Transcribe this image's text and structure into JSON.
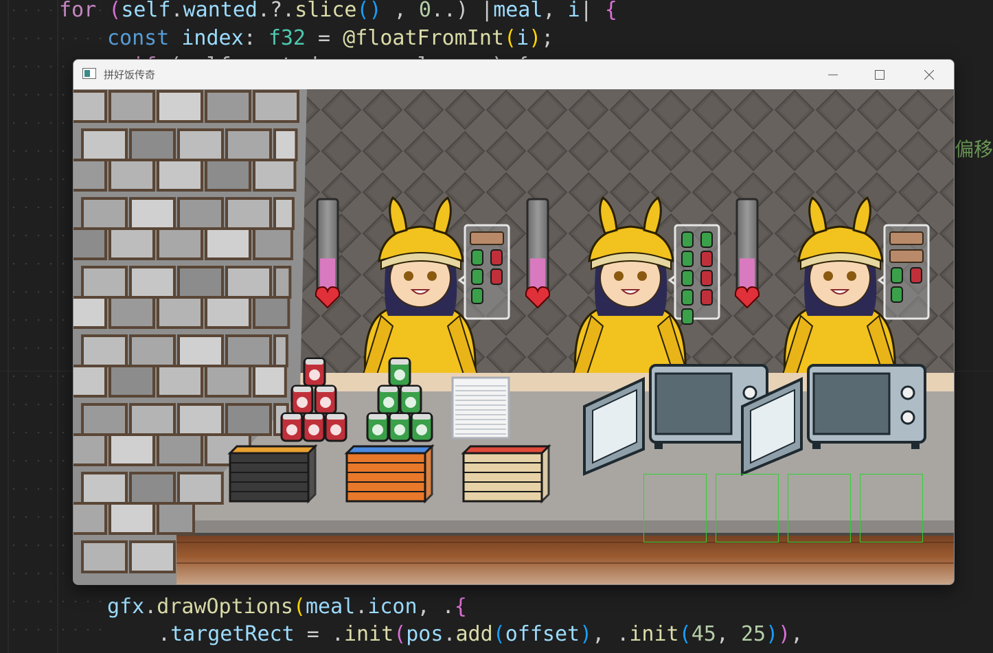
{
  "editor": {
    "lines": [
      {
        "parts": [
          [
            "kw",
            "for "
          ],
          [
            "br",
            "("
          ],
          [
            "id",
            "self"
          ],
          [
            "",
            "."
          ],
          [
            "id",
            "wanted"
          ],
          [
            "",
            ".?."
          ],
          [
            "fn",
            "slice"
          ],
          [
            "br2",
            "()"
          ],
          [
            "",
            " , "
          ],
          [
            "num",
            "0"
          ],
          [
            "",
            "..) |"
          ],
          [
            "id",
            "meal"
          ],
          [
            "",
            ", "
          ],
          [
            "id",
            "i"
          ],
          [
            "",
            "| "
          ],
          [
            "br",
            "{"
          ]
        ]
      },
      {
        "parts": [
          [
            "kw2",
            "const "
          ],
          [
            "id",
            "index"
          ],
          [
            "",
            ": "
          ],
          [
            "ty",
            "f32"
          ],
          [
            "",
            " = "
          ],
          [
            "fn",
            "@floatFromInt"
          ],
          [
            "br3",
            "("
          ],
          [
            "id",
            "i"
          ],
          [
            "br3",
            ")"
          ],
          [
            "",
            ";"
          ]
        ]
      },
      {
        "parts": [
          [
            "",
            "  "
          ],
          [
            "kw",
            "if"
          ],
          [
            "",
            " (self.wanted ... meal ... ) {"
          ]
        ]
      },
      {
        "parts": [
          [
            "id",
            "gfx"
          ],
          [
            "",
            "."
          ],
          [
            "fn",
            "drawOptions"
          ],
          [
            "br3",
            "("
          ],
          [
            "id",
            "meal"
          ],
          [
            "",
            "."
          ],
          [
            "id",
            "icon"
          ],
          [
            "",
            ", ."
          ],
          [
            "br",
            "{"
          ]
        ]
      },
      {
        "parts": [
          [
            "",
            "."
          ],
          [
            "id",
            "targetRect"
          ],
          [
            "",
            " = ."
          ],
          [
            "fn",
            "init"
          ],
          [
            "br",
            "("
          ],
          [
            "id",
            "pos"
          ],
          [
            "",
            "."
          ],
          [
            "fn",
            "add"
          ],
          [
            "br2",
            "("
          ],
          [
            "id",
            "offset"
          ],
          [
            "br2",
            ")"
          ],
          [
            "",
            ", ."
          ],
          [
            "fn",
            "init"
          ],
          [
            "br2",
            "("
          ],
          [
            "num",
            "45"
          ],
          [
            "",
            ", "
          ],
          [
            "num",
            "25"
          ],
          [
            "br2",
            ")"
          ],
          [
            "br",
            ")"
          ],
          [
            "",
            ","
          ]
        ]
      }
    ],
    "side_comment": "的偏移"
  },
  "window": {
    "title": "拼好饭传奇",
    "controls": [
      "minimize-icon",
      "maximize-icon",
      "close-icon"
    ]
  },
  "game": {
    "customers": [
      {
        "patience": 0.35,
        "order": [
          "tray",
          "can-green",
          "can-red",
          "can-green",
          "can-red",
          "can-green"
        ]
      },
      {
        "patience": 0.35,
        "order": [
          "can-green",
          "can-green",
          "can-green",
          "can-red",
          "can-green",
          "can-red",
          "can-green",
          "can-red",
          "can-green"
        ]
      },
      {
        "patience": 0.35,
        "order": [
          "tray",
          "tray",
          "can-green",
          "can-red",
          "can-green"
        ]
      }
    ],
    "stock": [
      "red-cans",
      "green-cans",
      "paper-stack",
      "meal-boxes-dark",
      "meal-boxes-orange",
      "meal-boxes-cream"
    ],
    "microwaves": 2,
    "drop_slots": 4,
    "colors": {
      "wall": "#5e5955",
      "counter": "#a9a6a2",
      "floor": "#8a4f2a",
      "suit": "#f2c21e",
      "slot": "#2fd12f"
    }
  }
}
